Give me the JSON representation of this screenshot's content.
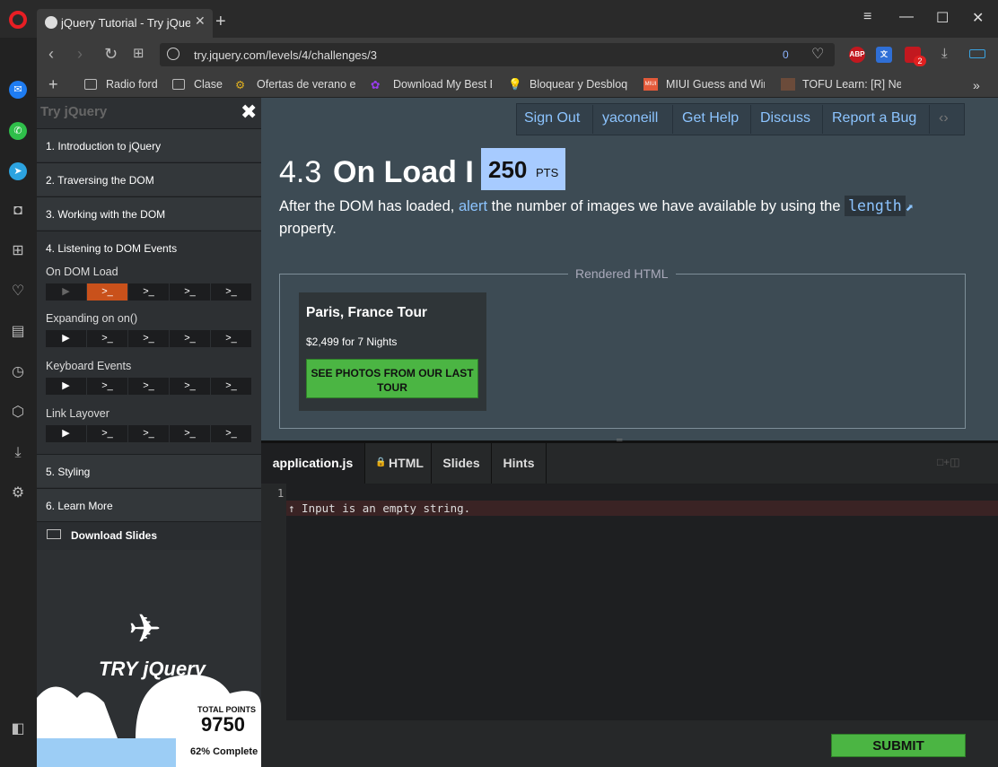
{
  "browser": {
    "tab_title": "jQuery Tutorial - Try jQuery",
    "url": "try.jquery.com/levels/4/challenges/3",
    "url_counter": "0",
    "bookmarks": [
      "Radio ford",
      "Clase",
      "Ofertas de verano en",
      "Download My Best E",
      "Bloquear y Desbloque",
      "MIUI Guess and Win",
      "TOFU Learn: [R] New"
    ],
    "ext_badge": "2"
  },
  "sidebar": {
    "brand": "Try jQuery",
    "levels": [
      {
        "label": "1. Introduction to jQuery"
      },
      {
        "label": "2. Traversing the DOM"
      },
      {
        "label": "3. Working with the DOM"
      },
      {
        "label": "4. Listening to DOM Events"
      },
      {
        "label": "5. Styling"
      },
      {
        "label": "6. Learn More"
      }
    ],
    "sub_sections": [
      "On DOM Load",
      "Expanding on on()",
      "Keyboard Events",
      "Link Layover"
    ],
    "download": "Download Slides",
    "points_label": "TOTAL POINTS",
    "points_value": "9750",
    "progress_label": "62% Complete",
    "progress": 0.62,
    "logo_text": "TRY jQuery"
  },
  "nav": {
    "items": [
      "Sign Out",
      "yaconeill",
      "Get Help",
      "Discuss",
      "Report a Bug"
    ]
  },
  "challenge": {
    "number": "4.3",
    "title": "On Load I",
    "points": "250",
    "points_unit": "PTS",
    "desc_1": "After the DOM has loaded, ",
    "desc_link": "alert",
    "desc_2": " the number of images we have available by using the ",
    "desc_code": "length",
    "desc_3": "property."
  },
  "rendered": {
    "label": "Rendered HTML",
    "tour_title": "Paris, France Tour",
    "tour_price": "$2,499 for 7 Nights",
    "tour_button": "SEE PHOTOS FROM OUR LAST TOUR"
  },
  "editor": {
    "tabs": [
      "application.js",
      "HTML",
      "Slides",
      "Hints"
    ],
    "line": "1",
    "error": "↑ Input is an empty string.",
    "submit": "SUBMIT"
  }
}
